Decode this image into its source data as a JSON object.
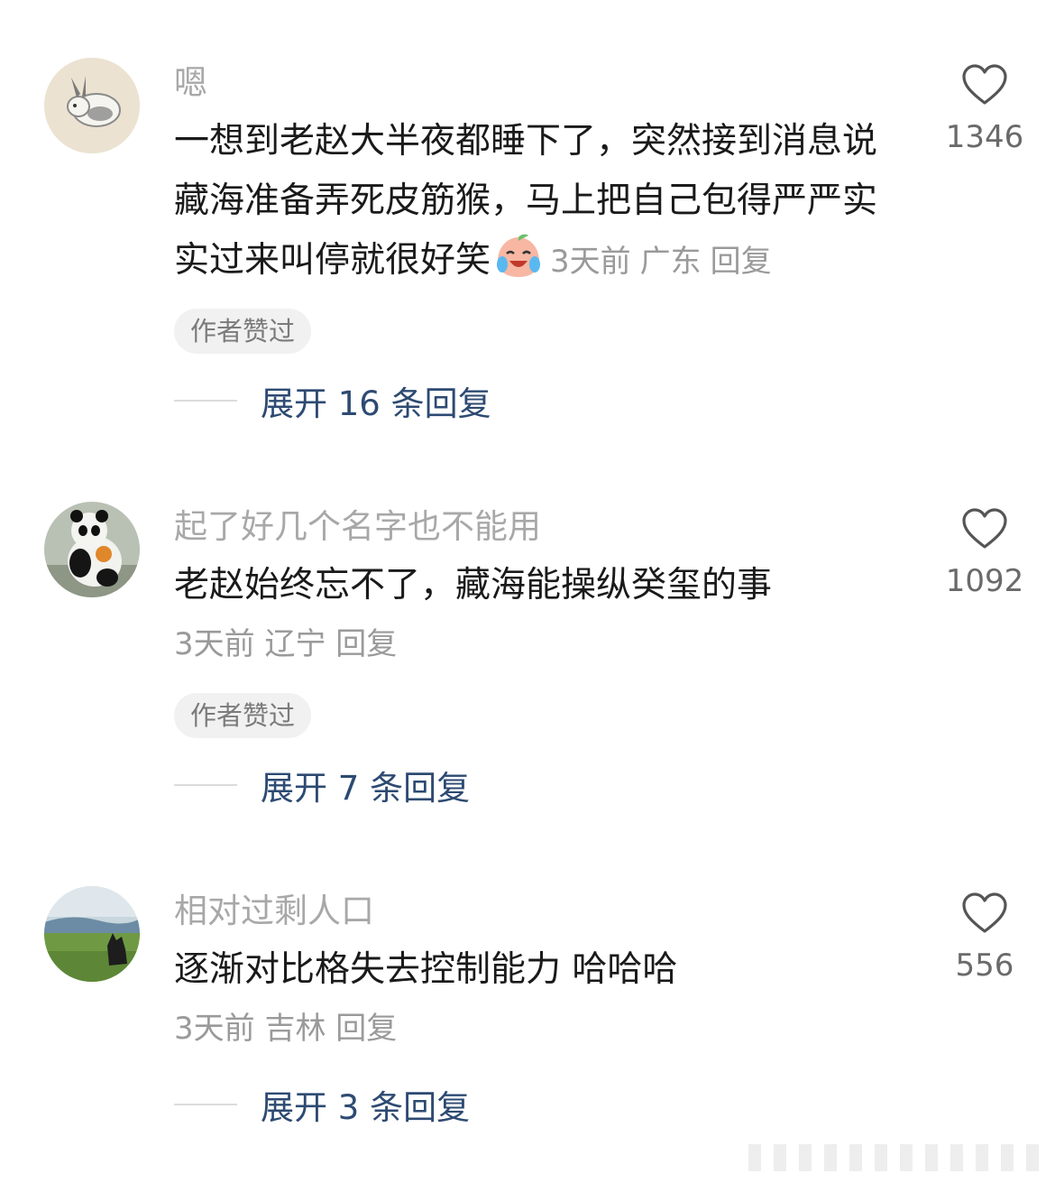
{
  "comments": [
    {
      "username": "嗯",
      "text": "一想到老赵大半夜都睡下了，突然接到消息说藏海准备弄死皮筋猴，马上把自己包得严严实实过来叫停就很好笑",
      "emoji_icon": "laugh-cry-peach-icon",
      "time": "3天前",
      "location": "广东",
      "reply_label": "回复",
      "badge": "作者赞过",
      "expand_label": "展开 16 条回复",
      "likes": "1346",
      "avatar_icon": "bunny-avatar"
    },
    {
      "username": "起了好几个名字也不能用",
      "text": "老赵始终忘不了，藏海能操纵癸玺的事",
      "time": "3天前",
      "location": "辽宁",
      "reply_label": "回复",
      "badge": "作者赞过",
      "expand_label": "展开 7 条回复",
      "likes": "1092",
      "avatar_icon": "panda-avatar"
    },
    {
      "username": "相对过剩人口",
      "text": "逐渐对比格失去控制能力 哈哈哈",
      "time": "3天前",
      "location": "吉林",
      "reply_label": "回复",
      "expand_label": "展开 3 条回复",
      "likes": "556",
      "avatar_icon": "landscape-dog-avatar"
    }
  ]
}
